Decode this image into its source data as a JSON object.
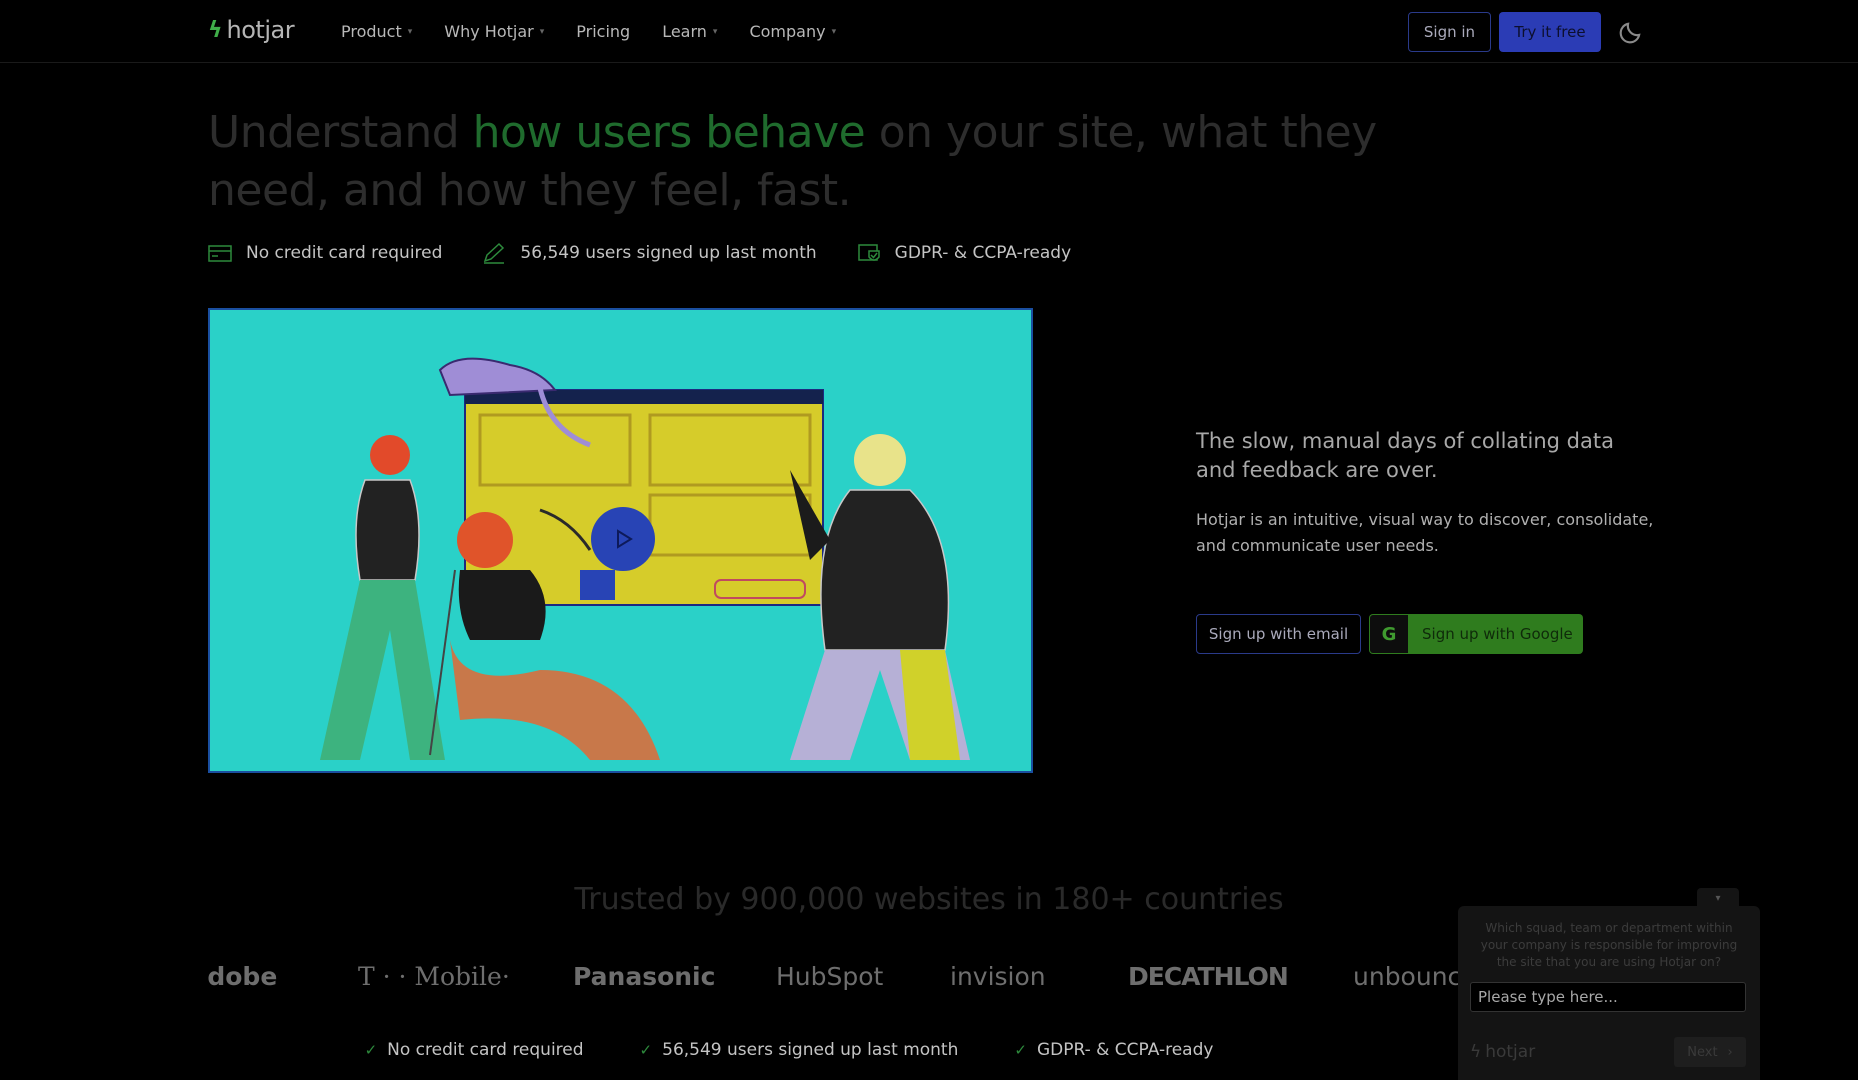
{
  "nav": {
    "logo_text": "hotjar",
    "items": [
      {
        "label": "Product",
        "has_caret": true
      },
      {
        "label": "Why Hotjar",
        "has_caret": true
      },
      {
        "label": "Pricing",
        "has_caret": false
      },
      {
        "label": "Learn",
        "has_caret": true
      },
      {
        "label": "Company",
        "has_caret": true
      }
    ],
    "signin_label": "Sign in",
    "try_label": "Try it free",
    "theme_icon": "moon-icon"
  },
  "hero": {
    "title_pre": "Understand ",
    "title_highlight": "how users behave",
    "title_post": " on your site, what they need, and how they feel, fast.",
    "badges": [
      {
        "icon": "credit-card-icon",
        "text": "No credit card required"
      },
      {
        "icon": "pencil-icon",
        "text": "56,549 users signed up last month"
      },
      {
        "icon": "shield-check-icon",
        "text": "GDPR- & CCPA-ready"
      }
    ]
  },
  "video": {
    "play_icon": "play-icon"
  },
  "side": {
    "headline": "The slow, manual days of collating data and feedback are over.",
    "body": "Hotjar is an intuitive, visual way to discover, consolidate, and communicate user needs.",
    "email_button": "Sign up with email",
    "google_button": "Sign up with Google"
  },
  "trusted": {
    "heading": "Trusted by 900,000 websites in 180+ countries",
    "logos": [
      "Adobe",
      "T · · Mobile·",
      "Panasonic",
      "HubSpot",
      "invision",
      "DECATHLON",
      "unbounce"
    ]
  },
  "bottom_badges": [
    "No credit card required",
    "56,549 users signed up last month",
    "GDPR- & CCPA-ready"
  ],
  "widget": {
    "question": "Which squad, team or department within your company is responsible for improving the site that you are using Hotjar on?",
    "input_placeholder": "Please type here...",
    "brand": "hotjar",
    "next_label": "Next"
  },
  "colors": {
    "accent_green": "#1f6b2d",
    "primary_blue": "#2b3cb5",
    "google_green": "#2f7c1e",
    "video_bg": "#2ad1c8"
  }
}
